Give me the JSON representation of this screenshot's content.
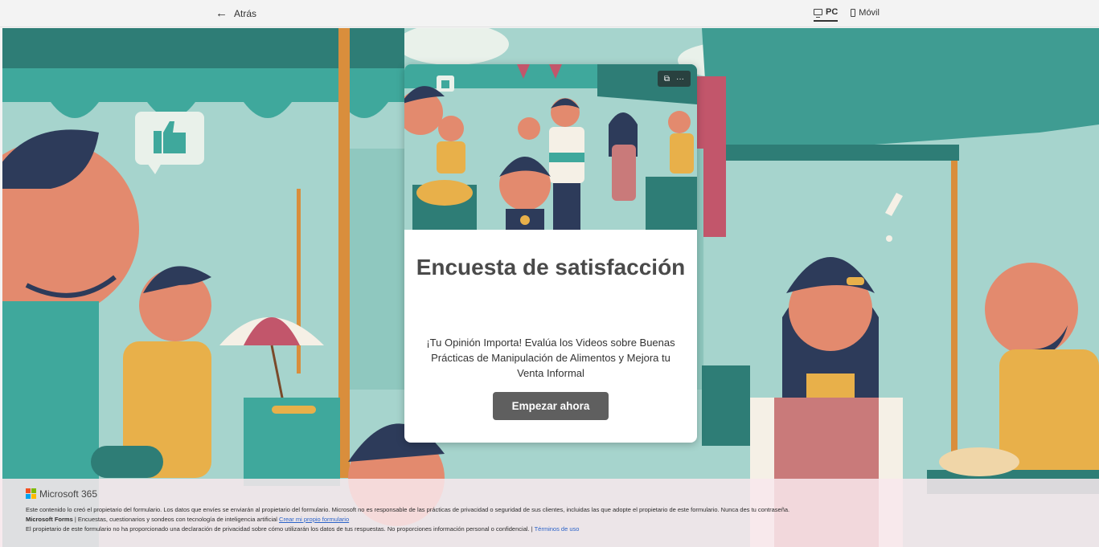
{
  "topbar": {
    "back_label": "Atrás",
    "devices": [
      {
        "label": "PC",
        "active": true,
        "icon": "monitor-icon"
      },
      {
        "label": "Móvil",
        "active": false,
        "icon": "phone-icon"
      }
    ]
  },
  "card": {
    "title": "Encuesta de satisfacción",
    "description": "¡Tu Opinión Importa! Evalúa los Videos sobre Buenas Prácticas de Manipulación de Alimentos y Mejora tu Venta Informal",
    "start_label": "Empezar ahora",
    "tools": {
      "reader_icon": "immersive-reader-icon",
      "more_label": "···"
    }
  },
  "footer": {
    "brand": "Microsoft 365",
    "line1": "Este contenido lo creó el propietario del formulario. Los datos que envíes se enviarán al propietario del formulario. Microsoft no es responsable de las prácticas de privacidad o seguridad de sus clientes, incluidas las que adopte el propietario de este formulario. Nunca des tu contraseña.",
    "forms_label": "Microsoft Forms",
    "line2": " | Encuestas, cuestionarios y sondeos con tecnología de inteligencia artificial ",
    "create_link": "Crear mi propio formulario",
    "line3": "El propietario de este formulario no ha proporcionado una declaración de privacidad sobre cómo utilizarán los datos de tus respuestas. No proporciones información personal o confidencial. | ",
    "terms_link": "Términos de uso"
  },
  "colors": {
    "background_teal": "#a6d4cd",
    "awning_teal": "#3fa89c",
    "dark_teal": "#2e7d76",
    "button_gray": "#5f5f5f",
    "footer_pink": "#f8e8ec"
  }
}
